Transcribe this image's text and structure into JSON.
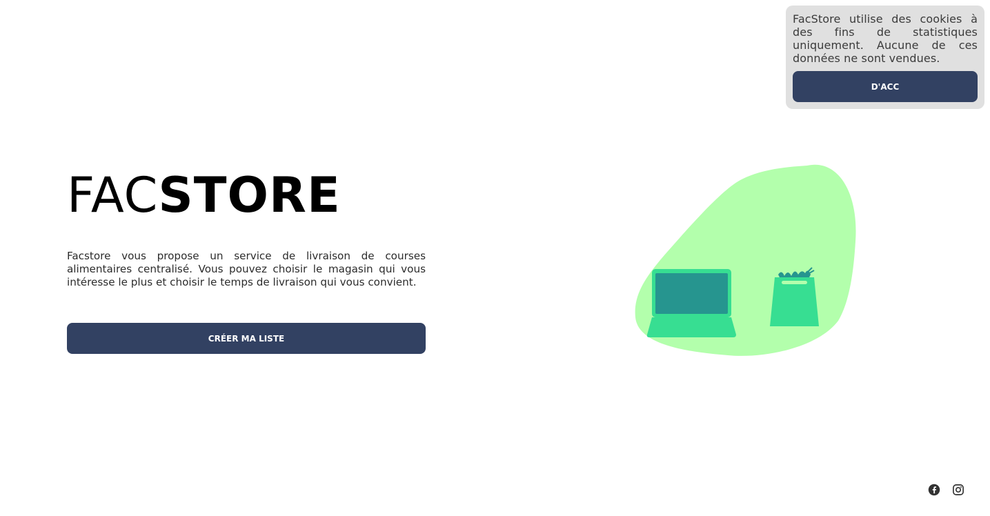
{
  "cookie_banner": {
    "text": "FacStore utilise des cookies à des fins de statistiques uniquement. Aucune de ces données ne sont vendues.",
    "accept_label": "D'ACC"
  },
  "hero": {
    "brand_light": "FAC",
    "brand_bold": "STORE",
    "description": "Facstore vous propose un service de livraison de courses alimentaires centralisé. Vous pouvez choisir le magasin qui vous intéresse le plus et choisir le temps de livraison qui vous convient.",
    "cta_label": "CRÉER MA LISTE"
  },
  "illustration": {
    "blob_color": "#b3ffac",
    "device_color": "#37de92",
    "screen_color": "#26958f",
    "icons": [
      "laptop-icon",
      "shopping-bag-icon"
    ]
  },
  "footer": {
    "social_icons": [
      "facebook-icon",
      "instagram-icon"
    ]
  },
  "colors": {
    "primary": "#324162",
    "banner_bg": "#e0e0e0"
  }
}
